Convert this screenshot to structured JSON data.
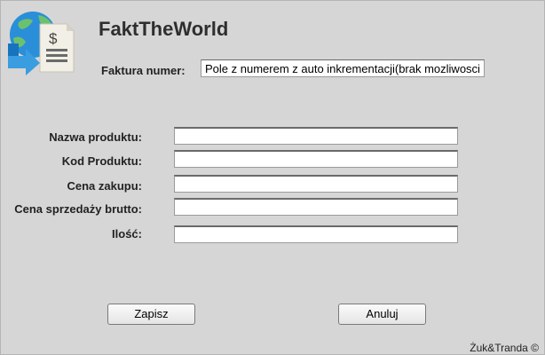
{
  "app": {
    "title": "FaktTheWorld"
  },
  "invoice": {
    "label": "Faktura numer:",
    "value": "Pole z numerem z auto inkrementacji(brak mozliwosci edycji)"
  },
  "form": {
    "fields": [
      {
        "label": "Nazwa produktu:",
        "value": ""
      },
      {
        "label": "Kod Produktu:",
        "value": ""
      },
      {
        "label": "Cena zakupu:",
        "value": ""
      },
      {
        "label": "Cena sprzedaży brutto:",
        "value": ""
      },
      {
        "label": "Ilość:",
        "value": ""
      }
    ]
  },
  "buttons": {
    "save_label": "Zapisz",
    "cancel_label": "Anuluj"
  },
  "footer": {
    "copyright": "Żuk&Tranda ©"
  },
  "colors": {
    "background": "#d6d6d6",
    "logo_blue": "#1e88d8",
    "logo_green": "#5cb85c"
  }
}
